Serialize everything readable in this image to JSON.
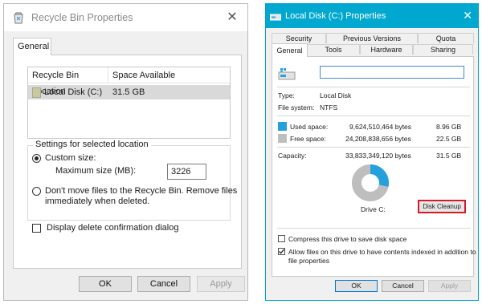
{
  "left_window": {
    "title": "Recycle Bin Properties",
    "tab": "General",
    "columns": [
      "Recycle Bin Location",
      "Space Available"
    ],
    "rows": [
      {
        "location": "Local Disk (C:)",
        "space": "31.5 GB"
      }
    ],
    "settings_legend": "Settings for selected location",
    "custom_size_label": "Custom size:",
    "max_size_label": "Maximum size (MB):",
    "max_size_value": "3226",
    "dont_move_line1": "Don't move files to the Recycle Bin. Remove files",
    "dont_move_line2": "immediately when deleted.",
    "confirm_label": "Display delete confirmation dialog",
    "buttons": {
      "ok": "OK",
      "cancel": "Cancel",
      "apply": "Apply"
    }
  },
  "right_window": {
    "title": "Local Disk (C:) Properties",
    "tabs_row1": [
      "Security",
      "Previous Versions",
      "Quota"
    ],
    "tabs_row2": [
      "General",
      "Tools",
      "Hardware",
      "Sharing"
    ],
    "type_label": "Type:",
    "type_value": "Local Disk",
    "fs_label": "File system:",
    "fs_value": "NTFS",
    "used_label": "Used space:",
    "used_bytes": "9,624,510,464 bytes",
    "used_gb": "8.96 GB",
    "free_label": "Free space:",
    "free_bytes": "24,208,838,656 bytes",
    "free_gb": "22.5 GB",
    "capacity_label": "Capacity:",
    "capacity_bytes": "33,833,349,120 bytes",
    "capacity_gb": "31.5 GB",
    "drive_label": "Drive C:",
    "disk_cleanup": "Disk Cleanup",
    "used_fraction": 0.284,
    "compress_label": "Compress this drive to save disk space",
    "index_line1": "Allow files on this drive to have contents indexed in addition to",
    "index_line2": "file properties",
    "buttons": {
      "ok": "OK",
      "cancel": "Cancel",
      "apply": "Apply"
    },
    "colors": {
      "used": "#26a0da",
      "free": "#bebebe",
      "accent": "#00a8cf"
    }
  }
}
